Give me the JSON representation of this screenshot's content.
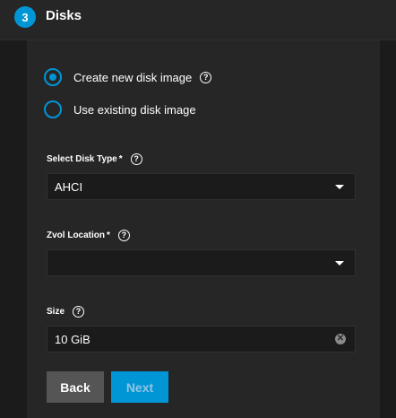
{
  "step": {
    "number": "3",
    "title": "Disks"
  },
  "disk_source": {
    "options": [
      {
        "label": "Create new disk image",
        "selected": true,
        "has_help": true
      },
      {
        "label": "Use existing disk image",
        "selected": false,
        "has_help": false
      }
    ]
  },
  "disk_type": {
    "label": "Select Disk Type",
    "required_mark": "*",
    "value": "AHCI"
  },
  "zvol_location": {
    "label": "Zvol Location",
    "required_mark": "*",
    "value": ""
  },
  "size": {
    "label": "Size",
    "value": "10 GiB"
  },
  "buttons": {
    "back": "Back",
    "next": "Next"
  },
  "help_glyph": "?",
  "clear_glyph": "✕",
  "colors": {
    "accent": "#0095d5",
    "panel": "#262626",
    "background": "#1b1b1b",
    "back_button": "#555555"
  }
}
